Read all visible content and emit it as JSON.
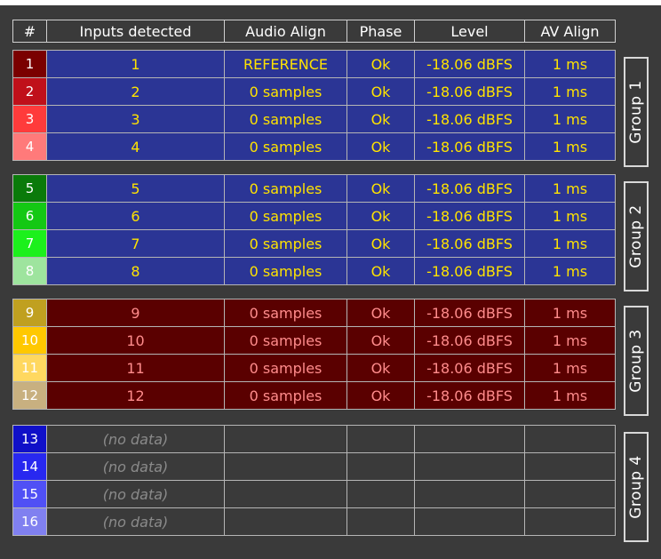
{
  "headers": [
    "#",
    "Inputs detected",
    "Audio Align",
    "Phase",
    "Level",
    "AV Align"
  ],
  "groups": [
    {
      "label": "Group 1",
      "style": "blue",
      "rows": [
        {
          "num": "1",
          "num_color": "#7a0000",
          "num_text_color": "#ffffff",
          "input": "1",
          "audio": "REFERENCE",
          "phase": "Ok",
          "level": "-18.06 dBFS",
          "av": "1 ms"
        },
        {
          "num": "2",
          "num_color": "#c0101a",
          "num_text_color": "#ffffff",
          "input": "2",
          "audio": "0 samples",
          "phase": "Ok",
          "level": "-18.06 dBFS",
          "av": "1 ms"
        },
        {
          "num": "3",
          "num_color": "#ff3b3b",
          "num_text_color": "#ffffff",
          "input": "3",
          "audio": "0 samples",
          "phase": "Ok",
          "level": "-18.06 dBFS",
          "av": "1 ms"
        },
        {
          "num": "4",
          "num_color": "#ff7a7a",
          "num_text_color": "#ffffff",
          "input": "4",
          "audio": "0 samples",
          "phase": "Ok",
          "level": "-18.06 dBFS",
          "av": "1 ms"
        }
      ]
    },
    {
      "label": "Group 2",
      "style": "blue",
      "rows": [
        {
          "num": "5",
          "num_color": "#0a7a0a",
          "num_text_color": "#ffffff",
          "input": "5",
          "audio": "0 samples",
          "phase": "Ok",
          "level": "-18.06 dBFS",
          "av": "1 ms"
        },
        {
          "num": "6",
          "num_color": "#14c814",
          "num_text_color": "#ffffff",
          "input": "6",
          "audio": "0 samples",
          "phase": "Ok",
          "level": "-18.06 dBFS",
          "av": "1 ms"
        },
        {
          "num": "7",
          "num_color": "#1cf01c",
          "num_text_color": "#ffffff",
          "input": "7",
          "audio": "0 samples",
          "phase": "Ok",
          "level": "-18.06 dBFS",
          "av": "1 ms"
        },
        {
          "num": "8",
          "num_color": "#9ee49e",
          "num_text_color": "#ffffff",
          "input": "8",
          "audio": "0 samples",
          "phase": "Ok",
          "level": "-18.06 dBFS",
          "av": "1 ms"
        }
      ]
    },
    {
      "label": "Group 3",
      "style": "red",
      "rows": [
        {
          "num": "9",
          "num_color": "#c0a020",
          "num_text_color": "#ffffff",
          "input": "9",
          "audio": "0 samples",
          "phase": "Ok",
          "level": "-18.06 dBFS",
          "av": "1 ms"
        },
        {
          "num": "10",
          "num_color": "#ffc800",
          "num_text_color": "#ffffff",
          "input": "10",
          "audio": "0 samples",
          "phase": "Ok",
          "level": "-18.06 dBFS",
          "av": "1 ms"
        },
        {
          "num": "11",
          "num_color": "#ffd860",
          "num_text_color": "#ffffff",
          "input": "11",
          "audio": "0 samples",
          "phase": "Ok",
          "level": "-18.06 dBFS",
          "av": "1 ms"
        },
        {
          "num": "12",
          "num_color": "#c8b080",
          "num_text_color": "#ffffff",
          "input": "12",
          "audio": "0 samples",
          "phase": "Ok",
          "level": "-18.06 dBFS",
          "av": "1 ms"
        }
      ]
    },
    {
      "label": "Group 4",
      "style": "empty",
      "rows": [
        {
          "num": "13",
          "num_color": "#1010c8",
          "num_text_color": "#ffffff",
          "input": "(no data)",
          "audio": "",
          "phase": "",
          "level": "",
          "av": ""
        },
        {
          "num": "14",
          "num_color": "#2828f0",
          "num_text_color": "#ffffff",
          "input": "(no data)",
          "audio": "",
          "phase": "",
          "level": "",
          "av": ""
        },
        {
          "num": "15",
          "num_color": "#5050f5",
          "num_text_color": "#ffffff",
          "input": "(no data)",
          "audio": "",
          "phase": "",
          "level": "",
          "av": ""
        },
        {
          "num": "16",
          "num_color": "#8080f0",
          "num_text_color": "#ffffff",
          "input": "(no data)",
          "audio": "",
          "phase": "",
          "level": "",
          "av": ""
        }
      ]
    }
  ]
}
